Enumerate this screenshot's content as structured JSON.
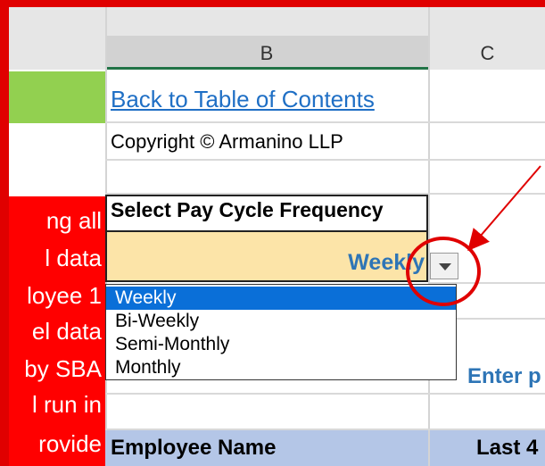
{
  "columns": {
    "b": "B",
    "c": "C"
  },
  "cells": {
    "back_link": "Back to Table of Contents",
    "copyright": "Copyright © Armanino LLP",
    "pay_cycle_label": "Select Pay Cycle Frequency",
    "pay_cycle_value": "Weekly",
    "enter_partial": "Enter p",
    "employee_name_header": "Employee Name",
    "last4_header": "Last 4"
  },
  "dropdown": {
    "options": [
      "Weekly",
      "Bi-Weekly",
      "Semi-Monthly",
      "Monthly"
    ],
    "selected_index": 0
  },
  "column_a_text": [
    "ng all",
    "l data",
    "loyee 1",
    "el data",
    "by SBA",
    "l run in",
    "rovide"
  ],
  "colors": {
    "annotation_red": "#e00000",
    "input_fill": "#fce4a8",
    "selected_option": "#0a6fd8",
    "link": "#1f6fc5",
    "header_blue": "#b4c6e7"
  },
  "icons": {
    "dropdown": "chevron-down-icon"
  }
}
